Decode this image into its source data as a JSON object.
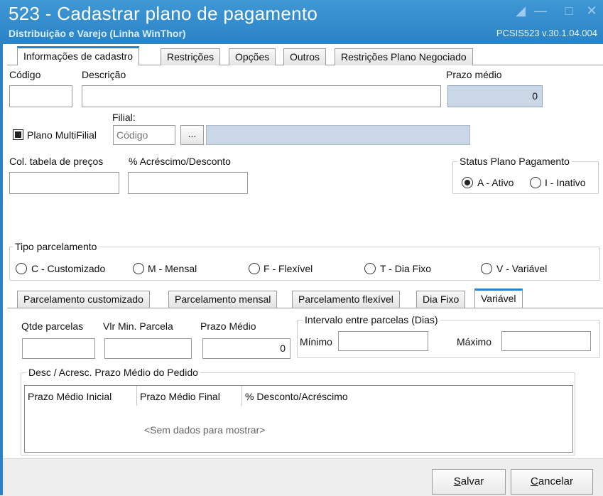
{
  "window": {
    "title": "523 - Cadastrar plano de pagamento",
    "subtitle": "Distribuição e Varejo (Linha WinThor)",
    "version": "PCSIS523  v.30.1.04.004",
    "accent": "#2a83c6"
  },
  "tabs_top": [
    {
      "label": "Informações de cadastro",
      "active": true
    },
    {
      "label": "Restrições",
      "active": false
    },
    {
      "label": "Opções",
      "active": false
    },
    {
      "label": "Outros",
      "active": false
    },
    {
      "label": "Restrições Plano Negociado",
      "active": false
    }
  ],
  "form": {
    "codigo_label": "Código",
    "descricao_label": "Descrição",
    "prazo_medio_label": "Prazo médio",
    "prazo_medio_value": "0",
    "filial_label": "Filial:",
    "multifilial_label": "Plano MultiFilial",
    "multifilial_checked": true,
    "filial_placeholder": "Código",
    "filial_button": "...",
    "col_tabela_label": "Col. tabela de preços",
    "acrescimo_label": "% Acréscimo/Desconto",
    "status_title": "Status Plano Pagamento",
    "status_ativo": "A - Ativo",
    "status_inativo": "I - Inativo"
  },
  "tipo_parcelamento": {
    "title": "Tipo parcelamento",
    "options": [
      "C - Customizado",
      "M - Mensal",
      "F - Flexível",
      "T - Dia Fixo",
      "V - Variável"
    ]
  },
  "tabs_bottom": [
    {
      "label": "Parcelamento customizado",
      "active": false
    },
    {
      "label": "Parcelamento mensal",
      "active": false
    },
    {
      "label": "Parcelamento flexível",
      "active": false
    },
    {
      "label": "Dia Fixo",
      "active": false
    },
    {
      "label": "Variável",
      "active": true
    }
  ],
  "variavel": {
    "qtde_label": "Qtde parcelas",
    "vlr_min_label": "Vlr Min. Parcela",
    "prazo_medio_label": "Prazo Médio",
    "prazo_medio_value": "0",
    "intervalo_title": "Intervalo entre parcelas (Dias)",
    "minimo_label": "Mínimo",
    "maximo_label": "Máximo",
    "desc_title": "Desc / Acresc.  Prazo Médio do Pedido",
    "columns": [
      "Prazo Médio Inicial",
      "Prazo Médio Final",
      "% Desconto/Acréscimo"
    ],
    "empty_text": "<Sem dados para mostrar>"
  },
  "buttons": {
    "salvar_prefix": "",
    "salvar_key": "S",
    "salvar_rest": "alvar",
    "cancelar_key": "C",
    "cancelar_rest": "ancelar"
  }
}
